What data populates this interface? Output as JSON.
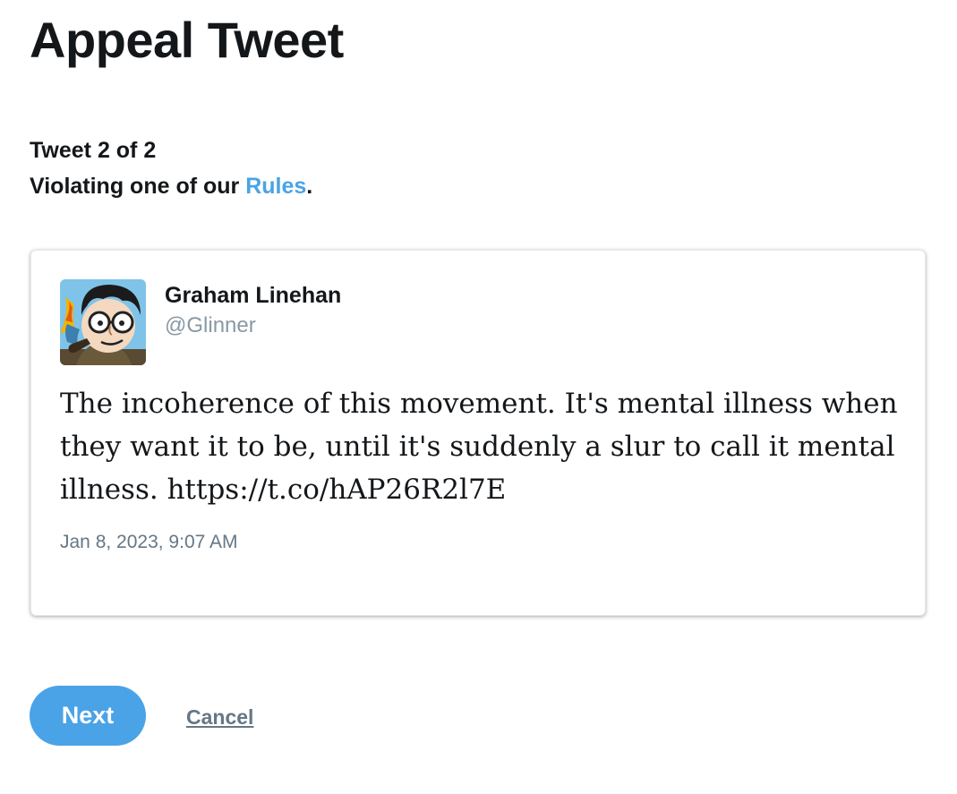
{
  "page": {
    "title": "Appeal Tweet",
    "counter": "Tweet 2 of 2",
    "violation_prefix": "Violating one of our ",
    "violation_link": "Rules",
    "violation_suffix": "."
  },
  "tweet": {
    "avatar_icon": "cartoon-avatar-icon",
    "author_name": "Graham Linehan",
    "author_handle": "@Glinner",
    "text": "The incoherence of this movement. It's mental illness when they want it to be, until it's suddenly a slur to call it mental illness. https://t.co/hAP26R2l7E",
    "timestamp": "Jan 8, 2023, 9:07 AM"
  },
  "actions": {
    "next_label": "Next",
    "cancel_label": "Cancel"
  },
  "colors": {
    "accent": "#4aa3e6",
    "text": "#14171a",
    "muted": "#657786",
    "handle": "#8899a6"
  }
}
